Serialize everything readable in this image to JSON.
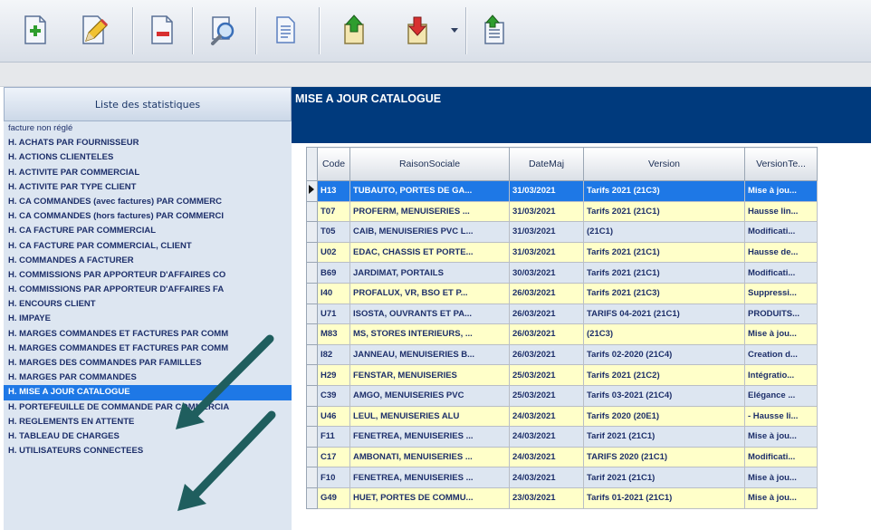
{
  "toolbar": {
    "buttons": [
      {
        "name": "add-document-icon",
        "color": "#2e9d2e"
      },
      {
        "name": "edit-pencil-icon",
        "color": "#e8b020"
      },
      {
        "name": "delete-document-icon",
        "color": "#d83030"
      },
      {
        "name": "search-zoom-icon",
        "color": "#3a6fb8"
      },
      {
        "name": "document-page-icon",
        "color": "#5a7fc0"
      },
      {
        "name": "upload-green-arrow-icon",
        "color": "#2e9d2e"
      },
      {
        "name": "download-red-arrow-icon",
        "color": "#d83030"
      },
      {
        "name": "chevron-down-icon",
        "color": "#304060"
      },
      {
        "name": "document-up-arrow-icon",
        "color": "#3a6fb8"
      }
    ]
  },
  "left_panel": {
    "header": "Liste des statistiques",
    "items": [
      "facture non réglé",
      "H. ACHATS PAR FOURNISSEUR",
      "H. ACTIONS CLIENTELES",
      "H. ACTIVITE PAR COMMERCIAL",
      "H. ACTIVITE PAR TYPE CLIENT",
      "H. CA COMMANDES (avec factures) PAR COMMERC",
      "H. CA COMMANDES (hors factures) PAR COMMERCI",
      "H. CA FACTURE PAR COMMERCIAL",
      "H. CA FACTURE PAR COMMERCIAL, CLIENT",
      "H. COMMANDES A FACTURER",
      "H. COMMISSIONS PAR APPORTEUR D'AFFAIRES CO",
      "H. COMMISSIONS PAR APPORTEUR D'AFFAIRES FA",
      "H. ENCOURS CLIENT",
      "H. IMPAYE",
      "H. MARGES COMMANDES ET FACTURES PAR COMM",
      "H. MARGES COMMANDES ET FACTURES PAR COMM",
      "H. MARGES DES COMMANDES PAR FAMILLES",
      "H. MARGES PAR COMMANDES",
      "H. MISE A JOUR CATALOGUE",
      "H. PORTEFEUILLE DE COMMANDE PAR COMMERCIA",
      "H. REGLEMENTS EN ATTENTE",
      "H. TABLEAU DE CHARGES",
      "H. UTILISATEURS CONNECTEES"
    ],
    "selected_index": 18
  },
  "right_panel": {
    "title": "MISE A JOUR CATALOGUE",
    "columns": [
      "Code",
      "RaisonSociale",
      "DateMaj",
      "Version",
      "VersionTe..."
    ],
    "rows": [
      [
        "H13",
        "TUBAUTO, PORTES DE GA...",
        "31/03/2021",
        "Tarifs 2021 (21C3)",
        "Mise à jou..."
      ],
      [
        "T07",
        "PROFERM, MENUISERIES ...",
        "31/03/2021",
        "Tarifs 2021 (21C1)",
        "Hausse lin..."
      ],
      [
        "T05",
        "CAIB, MENUISERIES PVC L...",
        "31/03/2021",
        "(21C1)",
        "Modificati..."
      ],
      [
        "U02",
        "EDAC, CHASSIS ET PORTE...",
        "31/03/2021",
        "Tarifs 2021 (21C1)",
        "Hausse de..."
      ],
      [
        "B69",
        "JARDIMAT, PORTAILS",
        "30/03/2021",
        "Tarifs 2021 (21C1)",
        "Modificati..."
      ],
      [
        "I40",
        "PROFALUX, VR, BSO ET P...",
        "26/03/2021",
        "Tarifs 2021 (21C3)",
        "Suppressi..."
      ],
      [
        "U71",
        "ISOSTA, OUVRANTS ET PA...",
        "26/03/2021",
        "TARIFS 04-2021 (21C1)",
        "PRODUITS..."
      ],
      [
        "M83",
        "MS, STORES INTERIEURS, ...",
        "26/03/2021",
        "(21C3)",
        "Mise à jou..."
      ],
      [
        "I82",
        "JANNEAU, MENUISERIES B...",
        "26/03/2021",
        "Tarifs 02-2020 (21C4)",
        "Creation d..."
      ],
      [
        "H29",
        "FENSTAR, MENUISERIES",
        "25/03/2021",
        "Tarifs 2021 (21C2)",
        "Intégratio..."
      ],
      [
        "C39",
        "AMGO, MENUISERIES PVC",
        "25/03/2021",
        "Tarifs 03-2021 (21C4)",
        "Elégance ..."
      ],
      [
        "U46",
        "LEUL, MENUISERIES ALU",
        "24/03/2021",
        "Tarifs 2020 (20E1)",
        "- Hausse li..."
      ],
      [
        "F11",
        "FENETREA, MENUISERIES ...",
        "24/03/2021",
        "Tarif 2021 (21C1)",
        "Mise à jou..."
      ],
      [
        "C17",
        "AMBONATI, MENUISERIES ...",
        "24/03/2021",
        "TARIFS 2020 (21C1)",
        "Modificati..."
      ],
      [
        "F10",
        "FENETREA, MENUISERIES ...",
        "24/03/2021",
        "Tarif 2021 (21C1)",
        "Mise à jou..."
      ],
      [
        "G49",
        "HUET, PORTES DE COMMU...",
        "23/03/2021",
        "Tarifs 01-2021 (21C1)",
        "Mise à jou..."
      ]
    ],
    "row_styles": [
      "sel",
      "yellow",
      "blue",
      "yellow",
      "blue",
      "yellow",
      "blue",
      "yellow",
      "blue",
      "yellow",
      "blue",
      "yellow",
      "blue",
      "yellow",
      "blue",
      "yellow"
    ]
  }
}
